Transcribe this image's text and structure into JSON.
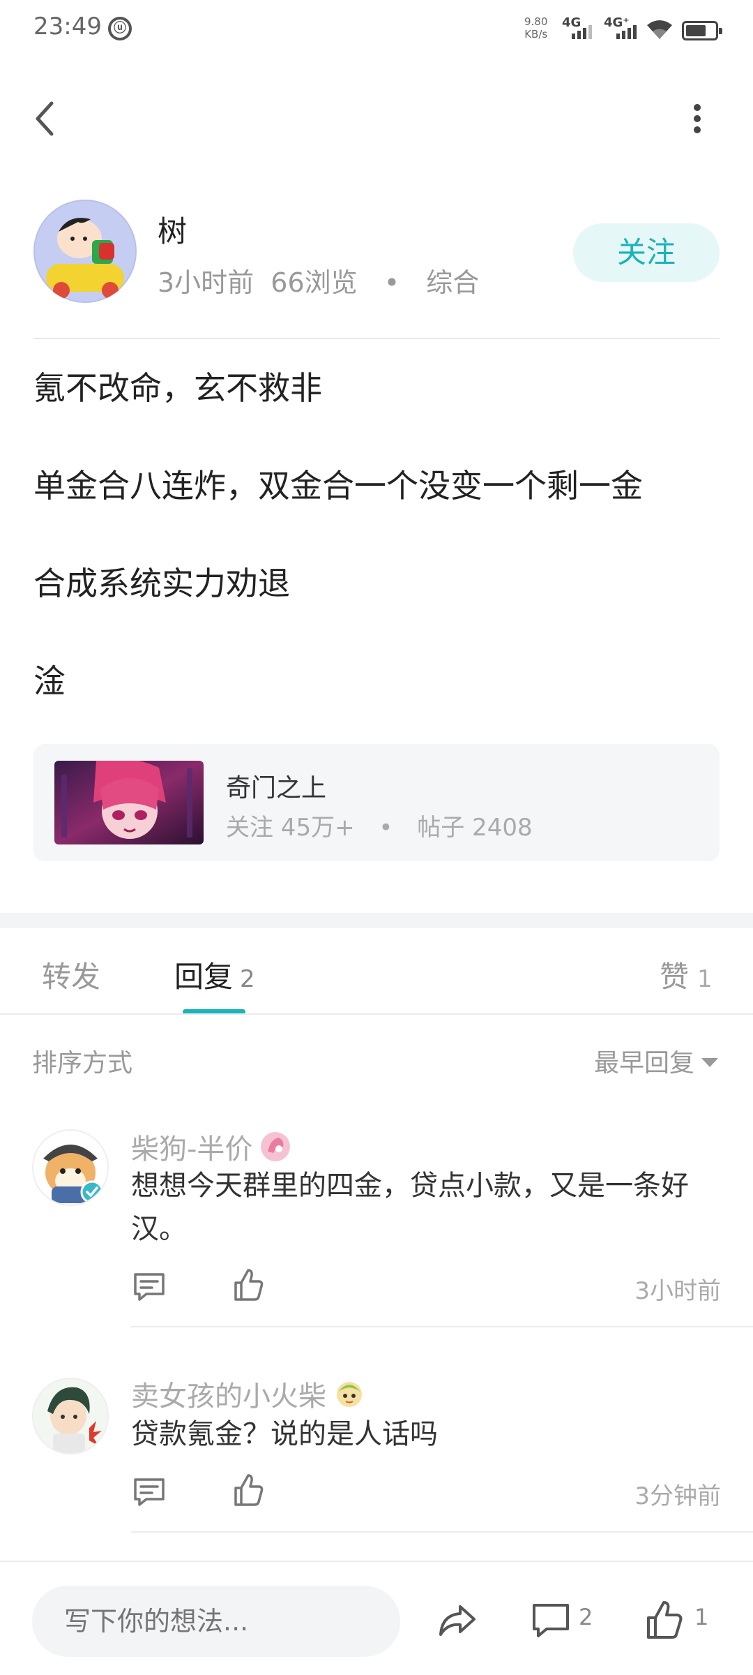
{
  "status_bar": {
    "time": "23:49",
    "badge": "ⓤ",
    "speed_value": "9.80",
    "speed_unit": "KB/s",
    "network_1": "4G",
    "network_2": "4G⁺",
    "battery_level": 0.7
  },
  "post": {
    "author_name": "树",
    "time_ago": "3小时前",
    "views": "66浏览",
    "separator": "•",
    "category": "综合",
    "follow_label": "关注",
    "lines": [
      "氪不改命，玄不救非",
      "单金合八连炸，双金合一个没变一个剩一金",
      "合成系统实力劝退",
      "淦"
    ]
  },
  "forum": {
    "name": "奇门之上",
    "followers": "关注 45万+",
    "separator": "•",
    "posts": "帖子 2408"
  },
  "tabs": {
    "forward": "转发",
    "reply": "回复",
    "reply_count": "2",
    "like": "赞",
    "like_count": "1"
  },
  "sort": {
    "label": "排序方式",
    "selected": "最早回复"
  },
  "comments": [
    {
      "name": "柴狗-半价",
      "text": "想想今天群里的四金，贷点小款，又是一条好汉。",
      "time": "3小时前"
    },
    {
      "name": "卖女孩的小火柴",
      "text": "贷款氪金？说的是人话吗",
      "time": "3分钟前"
    }
  ],
  "bottom_bar": {
    "input_placeholder": "写下你的想法...",
    "comment_count": "2",
    "like_count": "1"
  },
  "colors": {
    "accent": "#19b3b8",
    "follow_bg": "#e6f7f7",
    "muted_text": "#999999"
  }
}
